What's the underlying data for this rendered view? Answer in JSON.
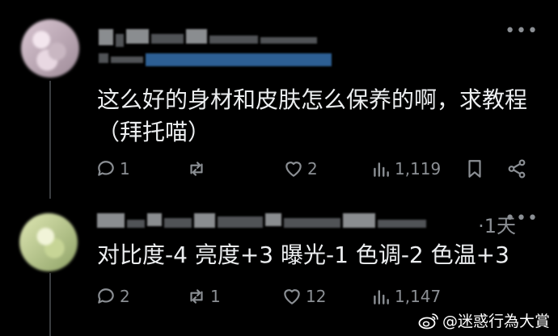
{
  "posts": [
    {
      "text_line1": "这么好的身材和皮肤怎么保养的啊，求教程",
      "text_line2": "（拜托喵）",
      "actions": {
        "replies": "1",
        "reposts": "",
        "likes": "2",
        "views": "1,119"
      }
    },
    {
      "time": "·1天",
      "text": "对比度-4 亮度+3 曝光-1 色调-2 色温+3",
      "actions": {
        "replies": "2",
        "reposts": "1",
        "likes": "12",
        "views": "1,147"
      }
    }
  ],
  "watermark": "@迷惑行為大賞",
  "icons": {
    "reply": "speech-bubble-icon",
    "repost": "repost-arrows-icon",
    "like": "heart-icon",
    "views": "bar-chart-icon",
    "bookmark": "bookmark-icon",
    "share": "share-icon",
    "more": "more-dots-icon",
    "weibo": "weibo-logo-icon"
  },
  "colors": {
    "background": "#000000",
    "text": "#eceef0",
    "muted": "#8b8f94"
  }
}
